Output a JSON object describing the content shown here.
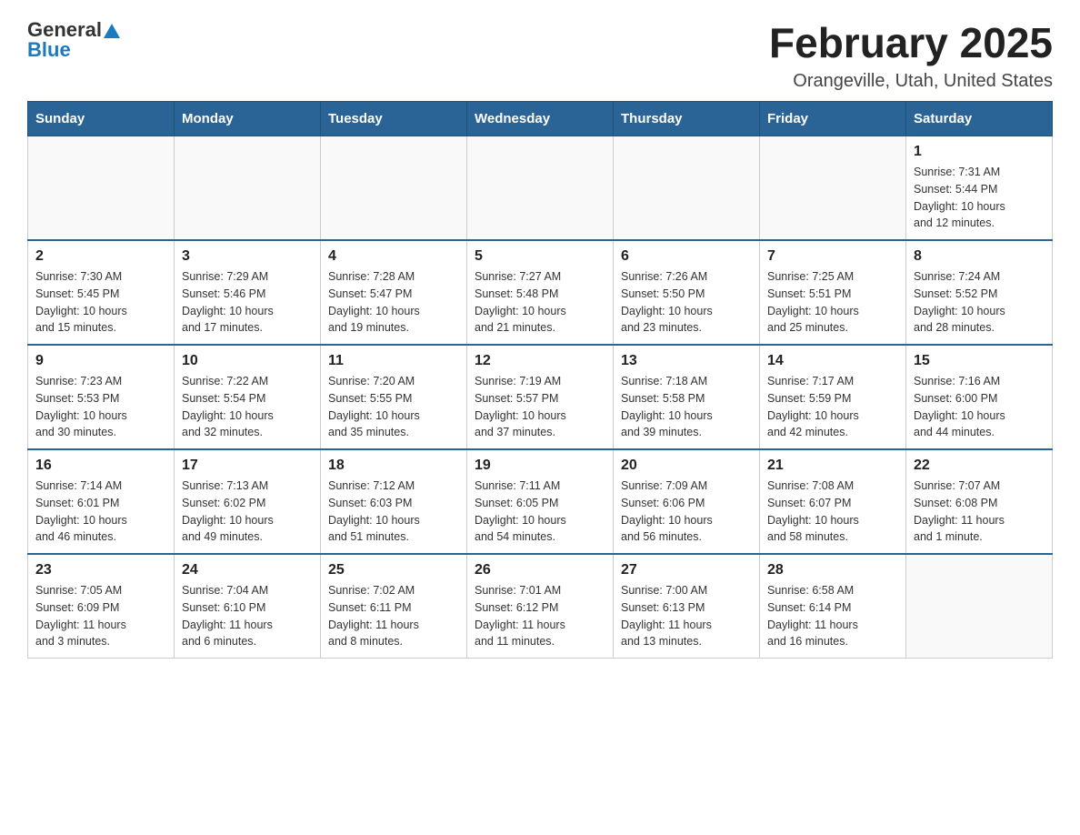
{
  "header": {
    "logo_general": "General",
    "logo_blue": "Blue",
    "title": "February 2025",
    "subtitle": "Orangeville, Utah, United States"
  },
  "weekdays": [
    "Sunday",
    "Monday",
    "Tuesday",
    "Wednesday",
    "Thursday",
    "Friday",
    "Saturday"
  ],
  "weeks": [
    [
      {
        "day": "",
        "info": ""
      },
      {
        "day": "",
        "info": ""
      },
      {
        "day": "",
        "info": ""
      },
      {
        "day": "",
        "info": ""
      },
      {
        "day": "",
        "info": ""
      },
      {
        "day": "",
        "info": ""
      },
      {
        "day": "1",
        "info": "Sunrise: 7:31 AM\nSunset: 5:44 PM\nDaylight: 10 hours\nand 12 minutes."
      }
    ],
    [
      {
        "day": "2",
        "info": "Sunrise: 7:30 AM\nSunset: 5:45 PM\nDaylight: 10 hours\nand 15 minutes."
      },
      {
        "day": "3",
        "info": "Sunrise: 7:29 AM\nSunset: 5:46 PM\nDaylight: 10 hours\nand 17 minutes."
      },
      {
        "day": "4",
        "info": "Sunrise: 7:28 AM\nSunset: 5:47 PM\nDaylight: 10 hours\nand 19 minutes."
      },
      {
        "day": "5",
        "info": "Sunrise: 7:27 AM\nSunset: 5:48 PM\nDaylight: 10 hours\nand 21 minutes."
      },
      {
        "day": "6",
        "info": "Sunrise: 7:26 AM\nSunset: 5:50 PM\nDaylight: 10 hours\nand 23 minutes."
      },
      {
        "day": "7",
        "info": "Sunrise: 7:25 AM\nSunset: 5:51 PM\nDaylight: 10 hours\nand 25 minutes."
      },
      {
        "day": "8",
        "info": "Sunrise: 7:24 AM\nSunset: 5:52 PM\nDaylight: 10 hours\nand 28 minutes."
      }
    ],
    [
      {
        "day": "9",
        "info": "Sunrise: 7:23 AM\nSunset: 5:53 PM\nDaylight: 10 hours\nand 30 minutes."
      },
      {
        "day": "10",
        "info": "Sunrise: 7:22 AM\nSunset: 5:54 PM\nDaylight: 10 hours\nand 32 minutes."
      },
      {
        "day": "11",
        "info": "Sunrise: 7:20 AM\nSunset: 5:55 PM\nDaylight: 10 hours\nand 35 minutes."
      },
      {
        "day": "12",
        "info": "Sunrise: 7:19 AM\nSunset: 5:57 PM\nDaylight: 10 hours\nand 37 minutes."
      },
      {
        "day": "13",
        "info": "Sunrise: 7:18 AM\nSunset: 5:58 PM\nDaylight: 10 hours\nand 39 minutes."
      },
      {
        "day": "14",
        "info": "Sunrise: 7:17 AM\nSunset: 5:59 PM\nDaylight: 10 hours\nand 42 minutes."
      },
      {
        "day": "15",
        "info": "Sunrise: 7:16 AM\nSunset: 6:00 PM\nDaylight: 10 hours\nand 44 minutes."
      }
    ],
    [
      {
        "day": "16",
        "info": "Sunrise: 7:14 AM\nSunset: 6:01 PM\nDaylight: 10 hours\nand 46 minutes."
      },
      {
        "day": "17",
        "info": "Sunrise: 7:13 AM\nSunset: 6:02 PM\nDaylight: 10 hours\nand 49 minutes."
      },
      {
        "day": "18",
        "info": "Sunrise: 7:12 AM\nSunset: 6:03 PM\nDaylight: 10 hours\nand 51 minutes."
      },
      {
        "day": "19",
        "info": "Sunrise: 7:11 AM\nSunset: 6:05 PM\nDaylight: 10 hours\nand 54 minutes."
      },
      {
        "day": "20",
        "info": "Sunrise: 7:09 AM\nSunset: 6:06 PM\nDaylight: 10 hours\nand 56 minutes."
      },
      {
        "day": "21",
        "info": "Sunrise: 7:08 AM\nSunset: 6:07 PM\nDaylight: 10 hours\nand 58 minutes."
      },
      {
        "day": "22",
        "info": "Sunrise: 7:07 AM\nSunset: 6:08 PM\nDaylight: 11 hours\nand 1 minute."
      }
    ],
    [
      {
        "day": "23",
        "info": "Sunrise: 7:05 AM\nSunset: 6:09 PM\nDaylight: 11 hours\nand 3 minutes."
      },
      {
        "day": "24",
        "info": "Sunrise: 7:04 AM\nSunset: 6:10 PM\nDaylight: 11 hours\nand 6 minutes."
      },
      {
        "day": "25",
        "info": "Sunrise: 7:02 AM\nSunset: 6:11 PM\nDaylight: 11 hours\nand 8 minutes."
      },
      {
        "day": "26",
        "info": "Sunrise: 7:01 AM\nSunset: 6:12 PM\nDaylight: 11 hours\nand 11 minutes."
      },
      {
        "day": "27",
        "info": "Sunrise: 7:00 AM\nSunset: 6:13 PM\nDaylight: 11 hours\nand 13 minutes."
      },
      {
        "day": "28",
        "info": "Sunrise: 6:58 AM\nSunset: 6:14 PM\nDaylight: 11 hours\nand 16 minutes."
      },
      {
        "day": "",
        "info": ""
      }
    ]
  ]
}
